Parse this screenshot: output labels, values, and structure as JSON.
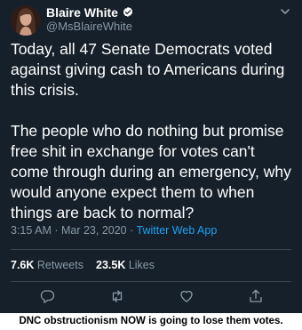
{
  "tweet": {
    "display_name": "Blaire White",
    "handle": "@MsBlaireWhite",
    "text": "Today, all 47 Senate Democrats voted against giving cash to Americans during this crisis.\n\nThe people who do nothing but promise free shit in exchange for votes can't come through during an emergency, why would anyone expect them to when things are back to normal?",
    "timestamp": "3:15 AM · Mar 23, 2020 · ",
    "source_app": "Twitter Web App",
    "retweets_count": "7.6K",
    "retweets_label": " Retweets",
    "likes_count": "23.5K",
    "likes_label": " Likes"
  },
  "icons": {
    "verified": "verified-badge-icon",
    "caret": "chevron-down-icon",
    "reply": "reply-icon",
    "retweet": "retweet-icon",
    "like": "heart-icon",
    "share": "share-icon"
  },
  "colors": {
    "background": "#15202b",
    "secondary_text": "#8899a6",
    "accent": "#1da1f2",
    "divider": "#38444d"
  },
  "caption": "DNC obstructionism NOW is going to lose them votes."
}
